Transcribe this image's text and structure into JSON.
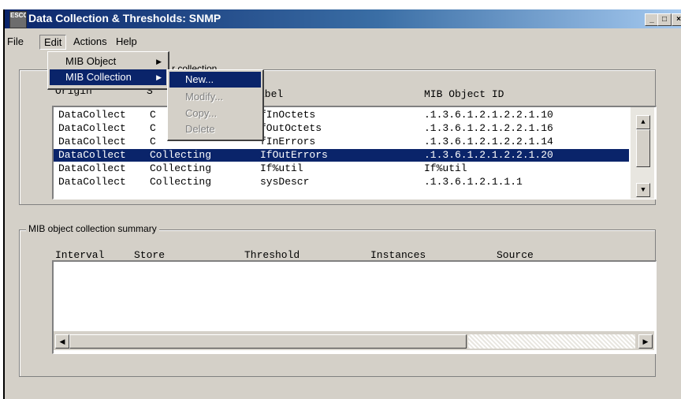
{
  "window": {
    "title": "Data Collection & Thresholds: SNMP",
    "app_icon_text": "ESCO"
  },
  "titlebar_buttons": {
    "minimize": "_",
    "maximize": "□",
    "close": "×"
  },
  "menubar": [
    "File",
    "Edit",
    "Actions",
    "Help"
  ],
  "edit_menu": {
    "items": [
      "MIB Object",
      "MIB Collection"
    ]
  },
  "collection_submenu": {
    "items": [
      "New...",
      "Modify...",
      "Copy...",
      "Delete"
    ]
  },
  "top_group": {
    "legend_fragment": "r collection",
    "headers": {
      "origin": "Origin",
      "state": "S",
      "label": "abel",
      "mib_id": "MIB Object ID"
    },
    "rows": [
      {
        "origin": "DataCollect",
        "state": "C",
        "label": "fInOctets",
        "mib_id": ".1.3.6.1.2.1.2.2.1.10"
      },
      {
        "origin": "DataCollect",
        "state": "C",
        "label": "fOutOctets",
        "mib_id": ".1.3.6.1.2.1.2.2.1.16"
      },
      {
        "origin": "DataCollect",
        "state": "C",
        "label": "fInErrors",
        "mib_id": ".1.3.6.1.2.1.2.2.1.14"
      },
      {
        "origin": "DataCollect",
        "state": "Collecting",
        "label": "IfOutErrors",
        "mib_id": ".1.3.6.1.2.1.2.2.1.20"
      },
      {
        "origin": "DataCollect",
        "state": "Collecting",
        "label": "If%util",
        "mib_id": "If%util"
      },
      {
        "origin": "DataCollect",
        "state": "Collecting",
        "label": "sysDescr",
        "mib_id": ".1.3.6.1.2.1.1.1"
      }
    ],
    "selected_row": 3
  },
  "summary_group": {
    "legend": "MIB object collection summary",
    "headers": {
      "interval": "Interval",
      "store": "Store",
      "threshold": "Threshold",
      "instances": "Instances",
      "source": "Source"
    }
  },
  "scroll_glyphs": {
    "up": "▲",
    "down": "▼",
    "left": "◀",
    "right": "▶"
  },
  "icons": {
    "submenu_arrow": "▶"
  }
}
